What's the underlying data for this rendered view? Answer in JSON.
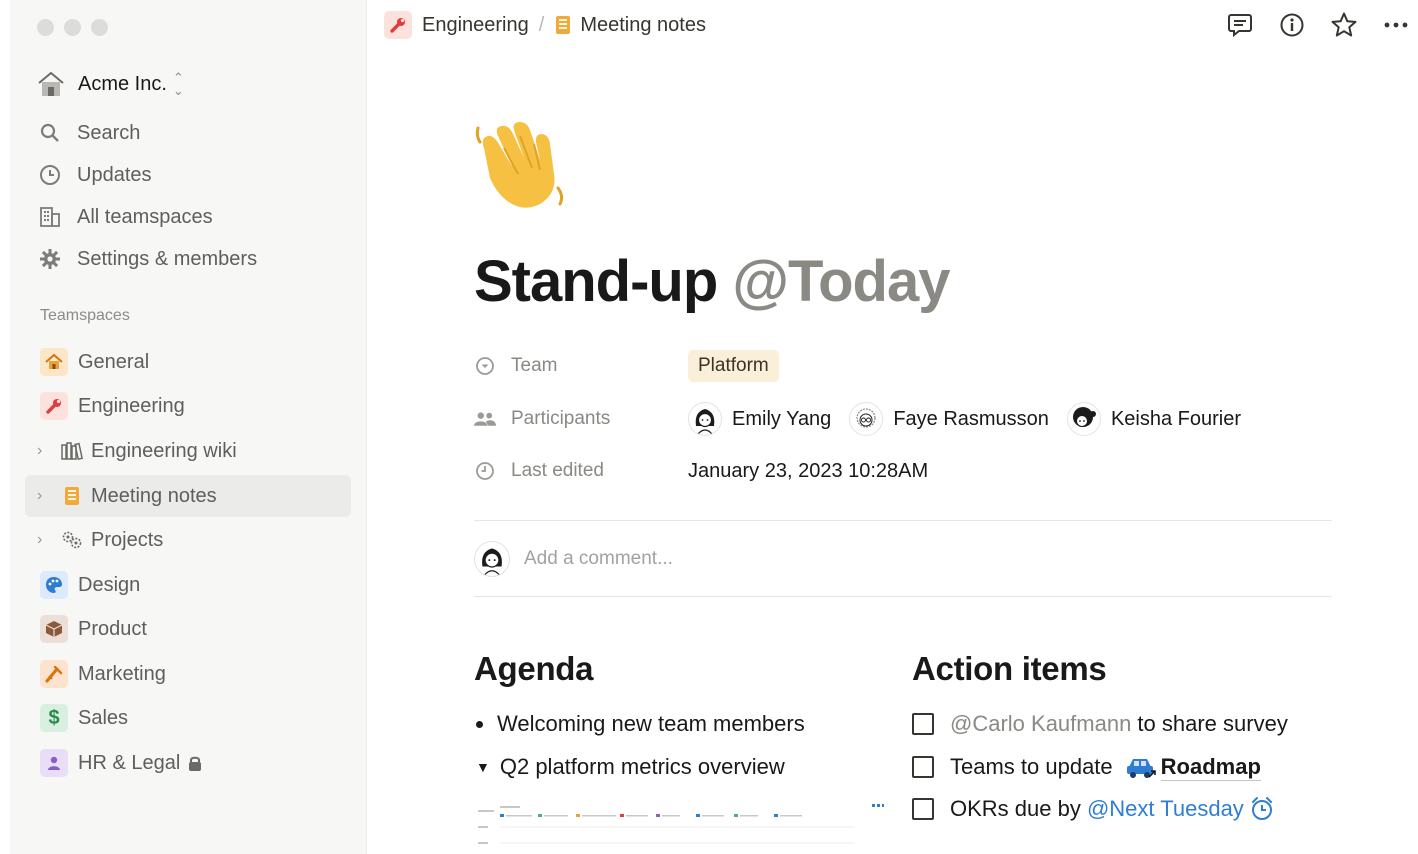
{
  "sidebar": {
    "workspace": {
      "name": "Acme Inc."
    },
    "nav": [
      {
        "label": "Search",
        "icon": "search-icon"
      },
      {
        "label": "Updates",
        "icon": "clock-icon"
      },
      {
        "label": "All teamspaces",
        "icon": "building-icon"
      },
      {
        "label": "Settings & members",
        "icon": "gear-icon"
      }
    ],
    "section_label": "Teamspaces",
    "teamspaces": [
      {
        "label": "General",
        "icon": "house-icon",
        "color": "#fbe6c7",
        "expandable": false
      },
      {
        "label": "Engineering",
        "icon": "wrench-icon",
        "color": "#fde1dd",
        "expandable": false
      },
      {
        "label": "Engineering wiki",
        "icon": "books-icon",
        "expandable": true
      },
      {
        "label": "Meeting notes",
        "icon": "notebook-icon",
        "expandable": true,
        "active": true
      },
      {
        "label": "Projects",
        "icon": "gears-icon",
        "expandable": true
      },
      {
        "label": "Design",
        "icon": "palette-icon",
        "color": "#dceafc",
        "expandable": false
      },
      {
        "label": "Product",
        "icon": "box-icon",
        "color": "#ecdfd8",
        "expandable": false
      },
      {
        "label": "Marketing",
        "icon": "megaphone-icon",
        "color": "#fde2cd",
        "expandable": false
      },
      {
        "label": "Sales",
        "icon": "dollar-icon",
        "color": "#d9efe2",
        "expandable": false
      },
      {
        "label": "HR & Legal",
        "icon": "person-icon",
        "color": "#e8def7",
        "expandable": false,
        "locked": true
      }
    ]
  },
  "breadcrumb": {
    "items": [
      "Engineering",
      "Meeting notes"
    ],
    "separator": "/"
  },
  "page": {
    "title": "Stand-up",
    "title_mention": "@Today",
    "properties": {
      "team": {
        "label": "Team",
        "value": "Platform"
      },
      "participants": {
        "label": "Participants",
        "people": [
          "Emily Yang",
          "Faye Rasmusson",
          "Keisha Fourier"
        ]
      },
      "last_edited": {
        "label": "Last edited",
        "value": "January 23, 2023 10:28AM"
      }
    },
    "comment_placeholder": "Add a comment...",
    "agenda": {
      "heading": "Agenda",
      "items": [
        "Welcoming new team members",
        "Q2 platform metrics overview"
      ]
    },
    "action_items": {
      "heading": "Action items",
      "items": [
        {
          "mention": "@Carlo Kaufmann",
          "text": " to share survey"
        },
        {
          "text": "Teams to update",
          "page_link": "Roadmap"
        },
        {
          "text": "OKRs due by ",
          "date_mention": "@Next Tuesday"
        }
      ]
    }
  },
  "colors": {
    "mention_grey": "#8a8984",
    "link_blue": "#2f7fd1",
    "tag_bg": "#faf0d9",
    "sidebar_bg": "#f7f7f5"
  }
}
